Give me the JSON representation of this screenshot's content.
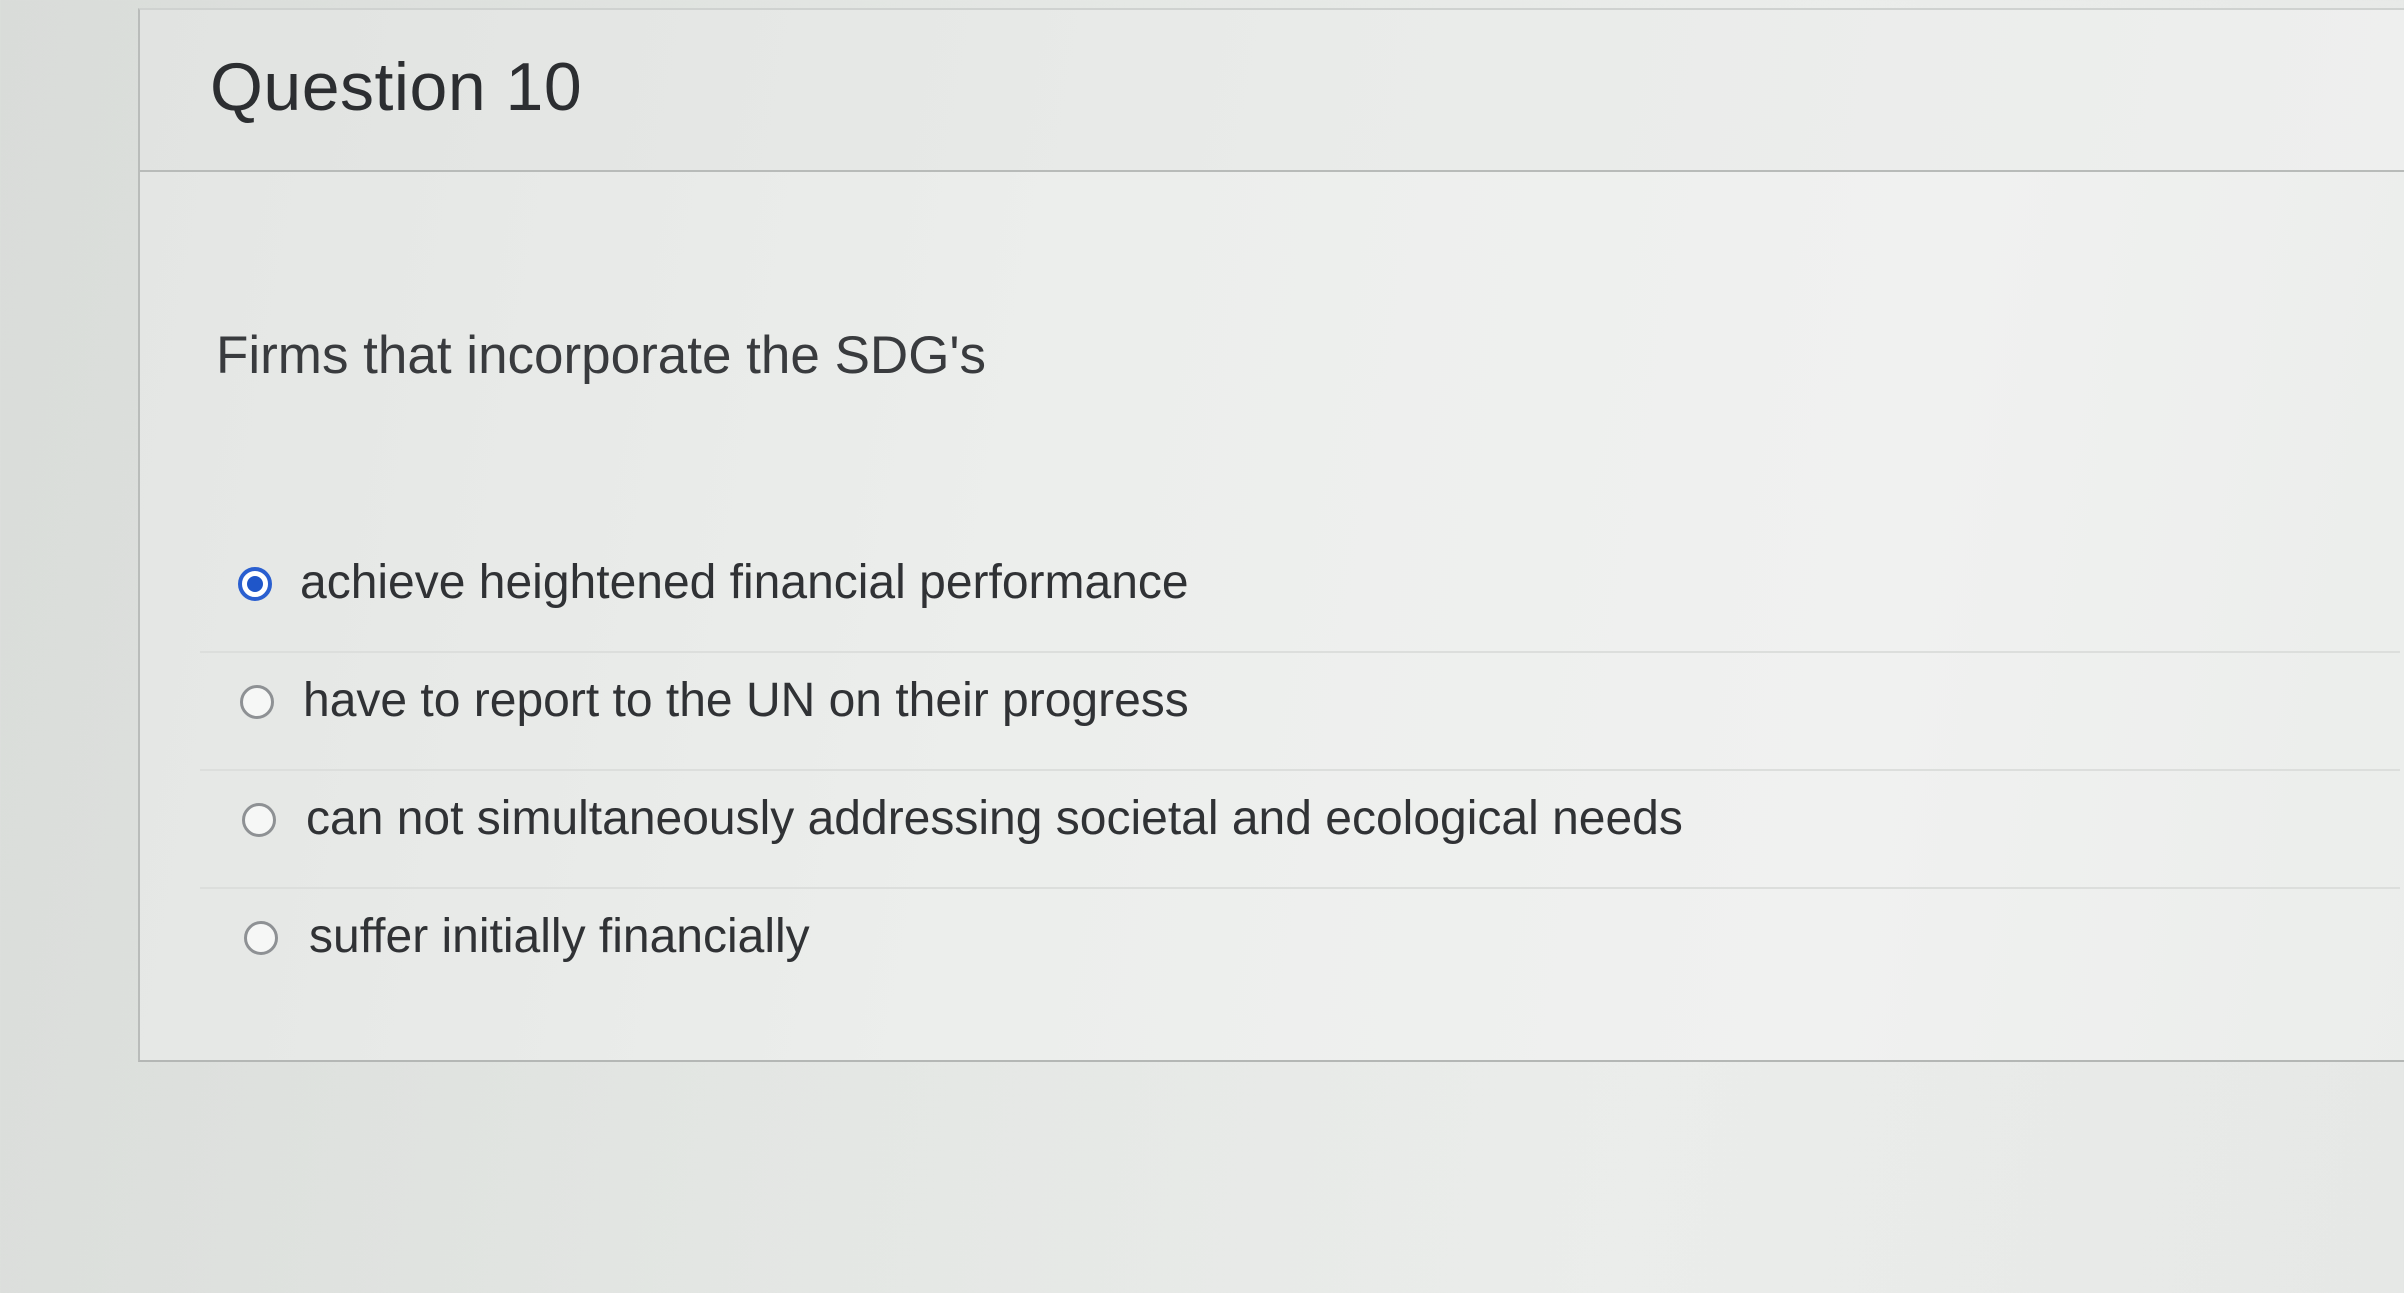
{
  "question": {
    "title": "Question 10",
    "prompt": "Firms that incorporate the SDG's"
  },
  "answers": [
    {
      "label": "achieve heightened financial performance",
      "selected": true
    },
    {
      "label": "have to report to the UN on their progress",
      "selected": false
    },
    {
      "label": "can not simultaneously addressing societal and ecological needs",
      "selected": false
    },
    {
      "label": "suffer initially financially",
      "selected": false
    }
  ],
  "colors": {
    "radio_selected": "#1f56c9",
    "text": "#2b2d30"
  }
}
